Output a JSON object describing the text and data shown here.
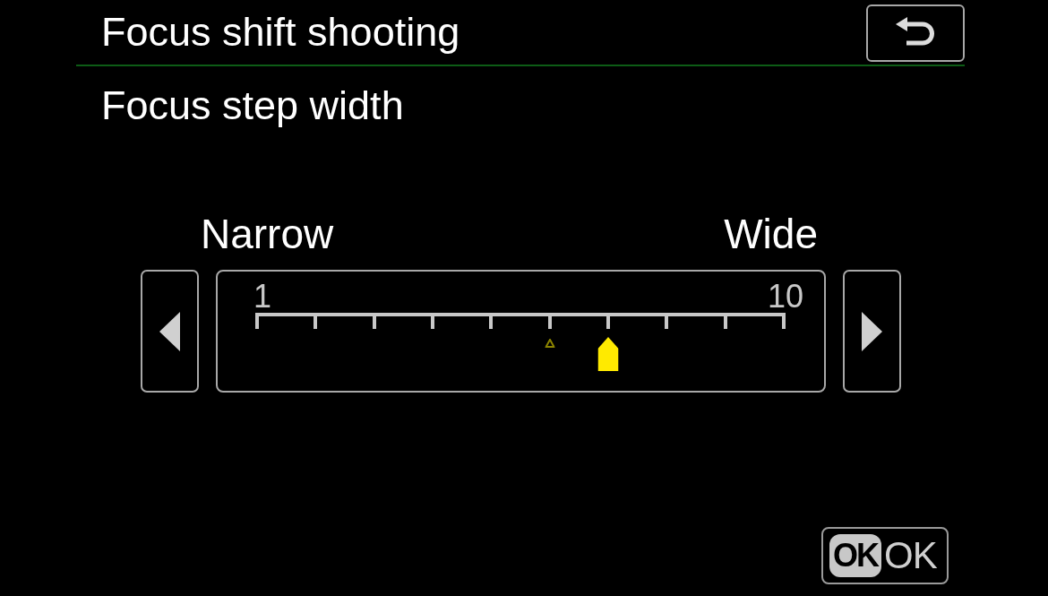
{
  "title": "Focus shift shooting",
  "setting": {
    "name": "Focus step width",
    "start_label": "Narrow",
    "end_label": "Wide",
    "min_label": "1",
    "max_label": "10",
    "level": 0.667,
    "steps": [
      {
        "default": false
      },
      {
        "default": false
      },
      {
        "default": false
      },
      {
        "default": false
      },
      {
        "default": false
      },
      {
        "default": true
      },
      {
        "default": false
      },
      {
        "default": false
      },
      {
        "default": false
      },
      {
        "default": false
      }
    ]
  },
  "ok_button": {
    "key": "OK",
    "label": "OK"
  }
}
